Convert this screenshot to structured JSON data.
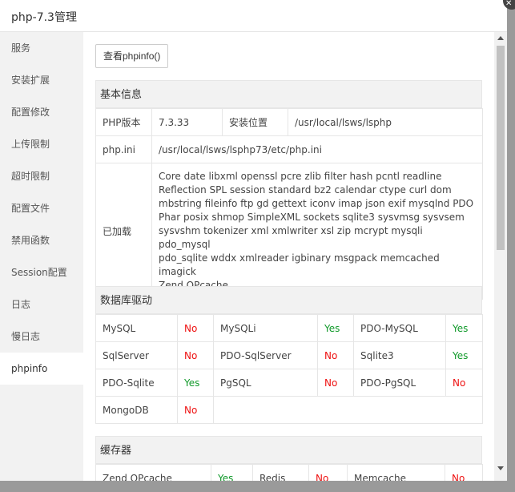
{
  "window": {
    "title": "php-7.3管理",
    "close_symbol": "✕"
  },
  "sidebar": {
    "items": [
      {
        "label": "服务"
      },
      {
        "label": "安装扩展"
      },
      {
        "label": "配置修改"
      },
      {
        "label": "上传限制"
      },
      {
        "label": "超时限制"
      },
      {
        "label": "配置文件"
      },
      {
        "label": "禁用函数"
      },
      {
        "label": "Session配置"
      },
      {
        "label": "日志"
      },
      {
        "label": "慢日志"
      },
      {
        "label": "phpinfo",
        "active": true
      }
    ]
  },
  "toolbar": {
    "phpinfo_button": "查看phpinfo()"
  },
  "basic_info": {
    "title": "基本信息",
    "php_version_label": "PHP版本",
    "php_version_value": "7.3.33",
    "install_path_label": "安装位置",
    "install_path_value": "/usr/local/lsws/lsphp",
    "php_ini_label": "php.ini",
    "php_ini_value": "/usr/local/lsws/lsphp73/etc/php.ini",
    "loaded_label": "已加载",
    "loaded_lines": [
      "Core date libxml openssl pcre zlib filter hash pcntl readline",
      "Reflection SPL session standard bz2 calendar ctype curl dom",
      "mbstring fileinfo ftp gd gettext iconv imap json exif mysqlnd PDO",
      "Phar posix shmop SimpleXML sockets sqlite3 sysvmsg sysvsem",
      "sysvshm tokenizer xml xmlwriter xsl zip mcrypt mysqli pdo_mysql",
      "pdo_sqlite wddx xmlreader igbinary msgpack memcached imagick",
      "Zend OPcache"
    ]
  },
  "db_drivers": {
    "title": "数据库驱动",
    "rows": [
      [
        {
          "name": "MySQL",
          "status": "No"
        },
        {
          "name": "MySQLi",
          "status": "Yes"
        },
        {
          "name": "PDO-MySQL",
          "status": "Yes"
        }
      ],
      [
        {
          "name": "SqlServer",
          "status": "No"
        },
        {
          "name": "PDO-SqlServer",
          "status": "No"
        },
        {
          "name": "Sqlite3",
          "status": "Yes"
        }
      ],
      [
        {
          "name": "PDO-Sqlite",
          "status": "Yes"
        },
        {
          "name": "PgSQL",
          "status": "No"
        },
        {
          "name": "PDO-PgSQL",
          "status": "No"
        }
      ],
      [
        {
          "name": "MongoDB",
          "status": "No"
        }
      ]
    ]
  },
  "cache": {
    "title": "缓存器",
    "rows": [
      [
        {
          "name": "Zend OPcache",
          "status": "Yes"
        },
        {
          "name": "Redis",
          "status": "No"
        },
        {
          "name": "Memcache",
          "status": "No"
        }
      ]
    ]
  },
  "colors": {
    "yes": "#129a2b",
    "no": "#ee1111",
    "sidebar_bg": "#f2f2f2",
    "section_bg": "#f2f2f2"
  }
}
